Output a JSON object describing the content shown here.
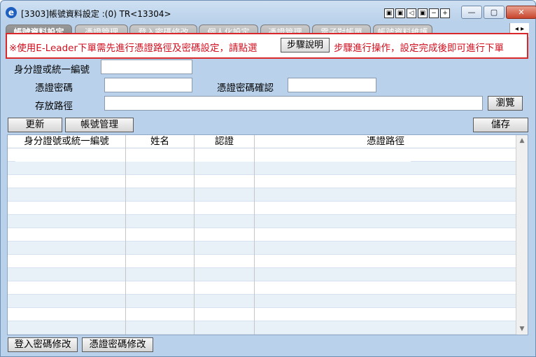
{
  "window": {
    "icon": "e",
    "title": "[3303]帳號資料設定 :(0) TR<13304>",
    "tool_icons": [
      "▣",
      "▣",
      "◁",
      "▣",
      "−",
      "+"
    ],
    "min_label": "—",
    "max_label": "▢",
    "close_label": "✕"
  },
  "tabs": [
    {
      "label": "帳號資料設定"
    },
    {
      "label": "憑證管理"
    },
    {
      "label": "登入密碼修改"
    },
    {
      "label": "個人化設定"
    },
    {
      "label": "憑證管理"
    },
    {
      "label": "電子對帳單"
    },
    {
      "label": "帳號資料維護"
    }
  ],
  "tab_scroll": "◂ ▸",
  "notice": {
    "text_before": "※使用E-Leader下單需先進行憑證路徑及密碼設定，請點選",
    "button": "步驟說明",
    "text_after": "步驟進行操作，設定完成後即可進行下單"
  },
  "form": {
    "id_label": "身分證或統一編號",
    "id_value": "",
    "cert_pw_label": "憑證密碼",
    "cert_pw_value": "",
    "cert_pw_confirm_label": "憑證密碼確認",
    "cert_pw_confirm_value": "",
    "path_label": "存放路徑",
    "path_value": "",
    "browse_button": "瀏覽"
  },
  "toolbar": {
    "refresh": "更新",
    "account_mgmt": "帳號管理",
    "save": "儲存"
  },
  "table": {
    "columns": [
      "身分證號或統一編號",
      "姓名",
      "認證",
      "憑證路徑"
    ],
    "rows": []
  },
  "scrollbar": {
    "up": "▲",
    "down": "▼"
  },
  "footer": {
    "login_pw_change": "登入密碼修改",
    "cert_pw_change": "憑證密碼修改"
  }
}
